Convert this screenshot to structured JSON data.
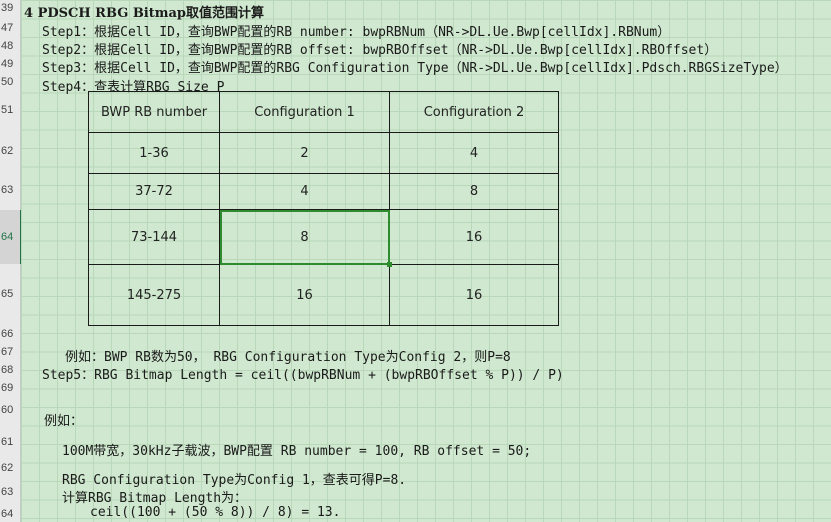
{
  "row_numbers": [
    "39",
    "47",
    "48",
    "49",
    "50",
    "51",
    "62",
    "63",
    "64",
    "65",
    "66",
    "67",
    "68",
    "69",
    "60",
    "61",
    "62",
    "63",
    "64"
  ],
  "lines": {
    "heading": "4 PDSCH RBG Bitmap取值范围计算",
    "step1": "Step1：根据Cell ID，查询BWP配置的RB number: bwpRBNum（NR->DL.Ue.Bwp[cellIdx].RBNum）",
    "step2": "Step2：根据Cell ID，查询BWP配置的RB offset: bwpRBOffset（NR->DL.Ue.Bwp[cellIdx].RBOffset）",
    "step3": "Step3：根据Cell ID，查询BWP配置的RBG Configuration Type（NR->DL.Ue.Bwp[cellIdx].Pdsch.RBGSizeType）",
    "step4": "Step4：查表计算RBG Size P",
    "example1": "例如：BWP RB数为50， RBG Configuration Type为Config 2，则P=8",
    "step5": "Step5：RBG Bitmap Length = ceil((bwpRBNum + (bwpRBOffset % P)) / P)",
    "example_head": "例如：",
    "example_a": "100M带宽，30kHz子载波，BWP配置 RB number = 100, RB offset = 50;",
    "example_b": "RBG  Configuration Type为Config 1，查表可得P=8.",
    "example_c": "计算RBG Bitmap Length为：",
    "example_d": "ceil((100 + (50 % 8)) / 8) = 13."
  },
  "table": {
    "headers": [
      "BWP RB number",
      "Configuration 1",
      "Configuration 2"
    ],
    "rows": [
      [
        "1-36",
        "2",
        "4"
      ],
      [
        "37-72",
        "4",
        "8"
      ],
      [
        "73-144",
        "8",
        "16"
      ],
      [
        "145-275",
        "16",
        "16"
      ]
    ]
  },
  "selected_cell": "73-144 / Configuration 1",
  "colors": {
    "sheet_background": "#cfe8cf",
    "selection": "#2e8b2e",
    "row_header": "#e9e9e9"
  }
}
